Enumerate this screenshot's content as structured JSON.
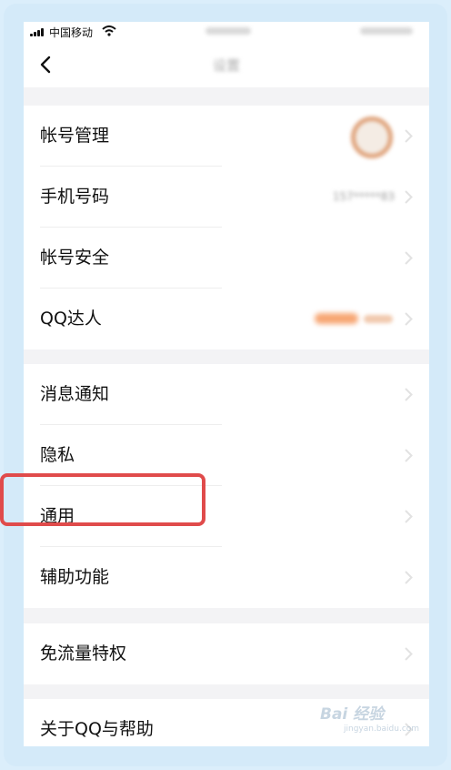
{
  "status_bar": {
    "carrier": "中国移动"
  },
  "nav": {
    "title": "设置"
  },
  "groups": [
    {
      "items": [
        {
          "label": "帐号管理"
        },
        {
          "label": "手机号码",
          "value": "157*****83"
        },
        {
          "label": "帐号安全"
        },
        {
          "label": "QQ达人"
        }
      ]
    },
    {
      "items": [
        {
          "label": "消息通知"
        },
        {
          "label": "隐私"
        },
        {
          "label": "通用"
        },
        {
          "label": "辅助功能"
        }
      ]
    },
    {
      "items": [
        {
          "label": "免流量特权"
        }
      ]
    },
    {
      "items": [
        {
          "label": "关于QQ与帮助"
        }
      ]
    }
  ],
  "highlight": {
    "target": "通用",
    "color": "#e04b4b"
  },
  "watermark": {
    "main": "Bai 经验",
    "sub": "jingyan.baidu.com"
  },
  "colors": {
    "page_bg": "#f3f3f5",
    "row_bg": "#ffffff",
    "accent_orange": "#f7a673"
  }
}
